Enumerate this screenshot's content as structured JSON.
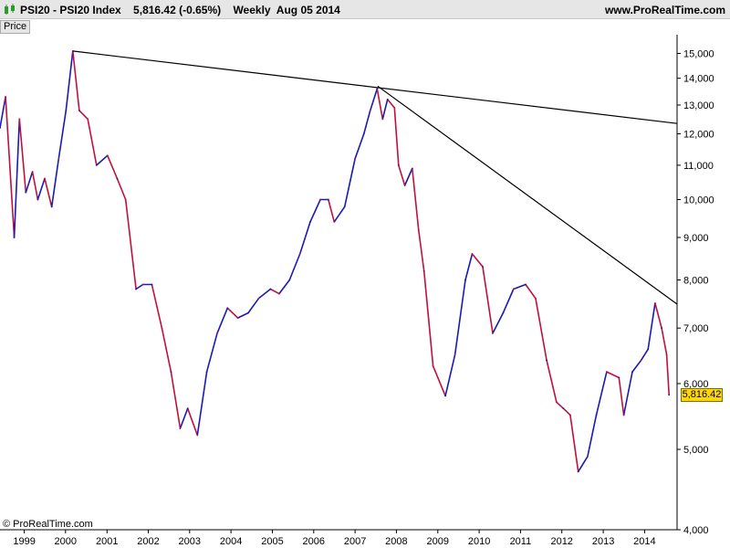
{
  "header": {
    "title": "PSI20 - PSI20 Index    5,816.42 (-0.65%)    Weekly  Aug 05 2014",
    "site": "www.ProRealTime.com"
  },
  "panel": {
    "tab_label": "Price"
  },
  "footer": {
    "copyright": "© ProRealTime.com"
  },
  "colors": {
    "up": "#1a1ab4",
    "down": "#c0103c",
    "trendline": "#000000",
    "last_label_bg": "#ffd800"
  },
  "chart_data": {
    "type": "line",
    "x_type": "date",
    "y_scale": "log",
    "ylim": [
      4000,
      15800
    ],
    "xlim": [
      "1998-06-01",
      "2014-10-15"
    ],
    "y_ticks": [
      4000,
      5000,
      6000,
      7000,
      8000,
      9000,
      10000,
      11000,
      12000,
      13000,
      14000,
      15000
    ],
    "y_tick_labels": [
      "4,000",
      "5,000",
      "6,000",
      "7,000",
      "8,000",
      "9,000",
      "10,000",
      "11,000",
      "12,000",
      "13,000",
      "14,000",
      "15,000"
    ],
    "x_ticks": [
      "1999-01-01",
      "2000-01-01",
      "2001-01-01",
      "2002-01-01",
      "2003-01-01",
      "2004-01-01",
      "2005-01-01",
      "2006-01-01",
      "2007-01-01",
      "2008-01-01",
      "2009-01-01",
      "2010-01-01",
      "2011-01-01",
      "2012-01-01",
      "2013-01-01",
      "2014-01-01"
    ],
    "x_tick_labels": [
      "1999",
      "2000",
      "2001",
      "2002",
      "2003",
      "2004",
      "2005",
      "2006",
      "2007",
      "2008",
      "2009",
      "2010",
      "2011",
      "2012",
      "2013",
      "2014"
    ],
    "series": [
      {
        "x": [
          "1998-06-01",
          "1998-07-20",
          "1998-10-05",
          "1998-11-20",
          "1999-01-15",
          "1999-03-15",
          "1999-05-01",
          "1999-07-01",
          "1999-09-01",
          "1999-11-01",
          "2000-01-05",
          "2000-03-05",
          "2000-05-01",
          "2000-07-15",
          "2000-10-01",
          "2001-01-05",
          "2001-04-01",
          "2001-06-15",
          "2001-09-15",
          "2001-11-15",
          "2002-02-01",
          "2002-05-01",
          "2002-07-20",
          "2002-10-10",
          "2002-12-15",
          "2003-03-10",
          "2003-06-01",
          "2003-09-01",
          "2003-12-01",
          "2004-03-01",
          "2004-06-01",
          "2004-09-01",
          "2004-12-15",
          "2005-03-01",
          "2005-06-01",
          "2005-09-01",
          "2005-12-01",
          "2006-03-01",
          "2006-05-10",
          "2006-07-01",
          "2006-10-01",
          "2007-01-01",
          "2007-03-20",
          "2007-05-15",
          "2007-07-15",
          "2007-09-01",
          "2007-10-15",
          "2007-12-15",
          "2008-01-20",
          "2008-03-15",
          "2008-05-20",
          "2008-07-15",
          "2008-09-01",
          "2008-11-20",
          "2009-03-09",
          "2009-06-01",
          "2009-09-01",
          "2009-11-01",
          "2010-02-01",
          "2010-05-01",
          "2010-08-01",
          "2010-11-01",
          "2011-02-15",
          "2011-05-15",
          "2011-08-20",
          "2011-11-15",
          "2012-01-15",
          "2012-03-15",
          "2012-05-25",
          "2012-08-15",
          "2012-11-01",
          "2013-02-01",
          "2013-05-20",
          "2013-07-01",
          "2013-09-15",
          "2013-12-01",
          "2014-02-01",
          "2014-04-04",
          "2014-06-01",
          "2014-07-15",
          "2014-08-05"
        ],
        "values": [
          12200,
          13300,
          9000,
          12500,
          10200,
          10800,
          10000,
          10600,
          9800,
          11200,
          12800,
          15100,
          12800,
          12500,
          11000,
          11300,
          10600,
          10000,
          7800,
          7900,
          7900,
          7000,
          6200,
          5300,
          5600,
          5200,
          6200,
          6900,
          7400,
          7200,
          7300,
          7600,
          7800,
          7700,
          8000,
          8600,
          9400,
          10000,
          10000,
          9400,
          9800,
          11200,
          12000,
          12800,
          13600,
          12500,
          13200,
          12900,
          11000,
          10400,
          10900,
          9200,
          8200,
          6300,
          5800,
          6500,
          8000,
          8600,
          8300,
          6900,
          7300,
          7800,
          7900,
          7600,
          6400,
          5700,
          5600,
          5500,
          4700,
          4900,
          5500,
          6200,
          6100,
          5500,
          6200,
          6400,
          6600,
          7500,
          7000,
          6500,
          5816.42
        ]
      }
    ],
    "trendlines": [
      {
        "x": [
          "2000-03-05",
          "2014-10-15"
        ],
        "y": [
          15100,
          12350
        ]
      },
      {
        "x": [
          "2007-07-20",
          "2014-10-15"
        ],
        "y": [
          13700,
          7480
        ]
      }
    ],
    "last_value_label": "5,816.42"
  }
}
